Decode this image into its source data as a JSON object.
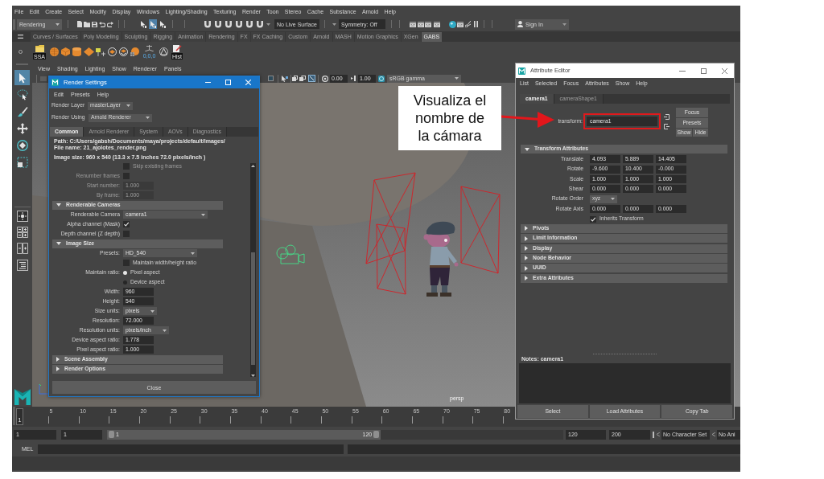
{
  "menu_bar": [
    "File",
    "Edit",
    "Create",
    "Select",
    "Modify",
    "Display",
    "Windows",
    "Lighting/Shading",
    "Texturing",
    "Render",
    "Toon",
    "Stereo",
    "Cache",
    "Substance",
    "Arnold",
    "Help"
  ],
  "status_line": {
    "menu_set": "Rendering",
    "select_modes": [
      {
        "selected": false
      },
      {
        "selected": true
      },
      {
        "selected": false
      }
    ],
    "live_surface": "No Live Surface",
    "symmetry": "Symmetry: Off",
    "sign_in": "Sign In"
  },
  "shelf": {
    "tabs": [
      {
        "label": "Curves / Surfaces",
        "selected": false
      },
      {
        "label": "Poly Modeling",
        "selected": false
      },
      {
        "label": "Sculpting",
        "selected": false
      },
      {
        "label": "Rigging",
        "selected": false
      },
      {
        "label": "Animation",
        "selected": false
      },
      {
        "label": "Rendering",
        "selected": false
      },
      {
        "label": "FX",
        "selected": false
      },
      {
        "label": "FX Caching",
        "selected": false
      },
      {
        "label": "Custom",
        "selected": false
      },
      {
        "label": "Arnold",
        "selected": false
      },
      {
        "label": "MASH",
        "selected": false
      },
      {
        "label": "Motion Graphics",
        "selected": false
      },
      {
        "label": "XGen",
        "selected": false
      },
      {
        "label": "GABS",
        "selected": true
      }
    ],
    "buttons": [
      {
        "kind": "folder",
        "label": "SSA"
      },
      {
        "kind": "sphere"
      },
      {
        "kind": "cube"
      },
      {
        "kind": "cylinder"
      },
      {
        "kind": "diamond"
      },
      {
        "kind": "target"
      },
      {
        "kind": "disc"
      },
      {
        "kind": "stack"
      },
      {
        "kind": "grid"
      },
      {
        "kind": "origin",
        "label": "0,0,0"
      },
      {
        "kind": "pivot"
      },
      {
        "kind": "notes",
        "label": "Hist"
      }
    ]
  },
  "toolbox": {
    "tools": [
      {
        "kind": "select",
        "selected": true
      },
      {
        "kind": "lasso",
        "selected": false
      },
      {
        "kind": "paint",
        "selected": false
      },
      {
        "kind": "move",
        "selected": false
      },
      {
        "kind": "rotate",
        "selected": false
      },
      {
        "kind": "scale",
        "selected": false
      }
    ]
  },
  "viewport": {
    "menu": [
      "View",
      "Shading",
      "Lighting",
      "Show",
      "Renderer",
      "Panels"
    ],
    "exposure": "0.00",
    "gamma": "1.00",
    "color_space": "sRGB gamma",
    "camera": "persp"
  },
  "render_settings": {
    "title": "Render Settings",
    "menu": [
      "Edit",
      "Presets",
      "Help"
    ],
    "render_layer": {
      "label": "Render Layer",
      "value": "masterLayer"
    },
    "render_using": {
      "label": "Render Using",
      "value": "Arnold Renderer"
    },
    "tabs": [
      {
        "label": "Common",
        "selected": true
      },
      {
        "label": "Arnold Renderer",
        "selected": false
      },
      {
        "label": "System",
        "selected": false
      },
      {
        "label": "AOVs",
        "selected": false
      },
      {
        "label": "Diagnostics",
        "selected": false
      }
    ],
    "path": "Path: C:/Users/gabsh/Documents/maya/projects/default/images/",
    "file_name": "File name: 21_ajolotes_render.png",
    "image_size": "Image size: 960 x 540 (13.3 x 7.5 inches 72.0 pixels/inch )",
    "rows": [
      {
        "kind": "checkoption",
        "text": "Skip existing frames",
        "checked": false,
        "disabled": true
      },
      {
        "kind": "checkbox",
        "label": "Renumber frames",
        "checked": false,
        "disabled": true
      },
      {
        "kind": "field",
        "label": "Start number:",
        "value": "1.000",
        "disabled": true
      },
      {
        "kind": "field",
        "label": "By frame:",
        "value": "1.000",
        "disabled": true
      },
      {
        "kind": "section",
        "label": "Renderable Cameras",
        "expanded": true
      },
      {
        "kind": "dropdown",
        "label": "Renderable Camera",
        "value": "camera1",
        "disabled": false
      },
      {
        "kind": "checkbox",
        "label": "Alpha channel (Mask)",
        "checked": true,
        "disabled": false
      },
      {
        "kind": "checkbox",
        "label": "Depth channel (Z depth)",
        "checked": false,
        "disabled": false
      },
      {
        "kind": "section",
        "label": "Image Size",
        "expanded": true
      },
      {
        "kind": "dropdown",
        "label": "Presets:",
        "value": "HD_540",
        "disabled": false
      },
      {
        "kind": "checkoption",
        "text": "Maintain width/height ratio",
        "checked": false,
        "disabled": false
      },
      {
        "kind": "radio",
        "label": "Maintain ratio:",
        "text": "Pixel aspect",
        "selected": true,
        "disabled": false
      },
      {
        "kind": "radio",
        "text": "Device aspect",
        "selected": false,
        "disabled": false
      },
      {
        "kind": "field",
        "label": "Width:",
        "value": "960",
        "disabled": false
      },
      {
        "kind": "field",
        "label": "Height:",
        "value": "540",
        "disabled": false
      },
      {
        "kind": "dropdown",
        "label": "Size units:",
        "value": "pixels",
        "disabled": false
      },
      {
        "kind": "field",
        "label": "Resolution:",
        "value": "72.000",
        "disabled": false
      },
      {
        "kind": "dropdown",
        "label": "Resolution units:",
        "value": "pixels/inch",
        "disabled": false
      },
      {
        "kind": "field",
        "label": "Device aspect ratio:",
        "value": "1.778",
        "disabled": false
      },
      {
        "kind": "field",
        "label": "Pixel aspect ratio:",
        "value": "1.000",
        "disabled": false
      },
      {
        "kind": "section",
        "label": "Scene Assembly",
        "expanded": false
      },
      {
        "kind": "section",
        "label": "Render Options",
        "expanded": false
      }
    ],
    "close": "Close"
  },
  "attribute_editor": {
    "title": "Attribute Editor",
    "menu": [
      "List",
      "Selected",
      "Focus",
      "Attributes",
      "Show",
      "Help"
    ],
    "tabs": [
      {
        "label": "camera1",
        "selected": true
      },
      {
        "label": "cameraShape1",
        "selected": false
      }
    ],
    "node": {
      "label": "transform:",
      "value": "camera1"
    },
    "buttons": [
      "Focus",
      "Presets",
      "Show",
      "Hide"
    ],
    "sections": [
      {
        "label": "Transform Attributes",
        "expanded": true,
        "rows": [
          {
            "kind": "vector",
            "label": "Translate",
            "values": [
              "4.093",
              "5.889",
              "14.405"
            ]
          },
          {
            "kind": "vector",
            "label": "Rotate",
            "values": [
              "-9.600",
              "10.400",
              "-0.000"
            ]
          },
          {
            "kind": "vector",
            "label": "Scale",
            "values": [
              "1.000",
              "1.000",
              "1.000"
            ]
          },
          {
            "kind": "vector",
            "label": "Shear",
            "values": [
              "0.000",
              "0.000",
              "0.000"
            ]
          },
          {
            "kind": "dropdown",
            "label": "Rotate Order",
            "value": "xyz"
          },
          {
            "kind": "vector",
            "label": "Rotate Axis",
            "values": [
              "0.000",
              "0.000",
              "0.000"
            ]
          },
          {
            "kind": "checkbox",
            "text": "Inherits Transform",
            "checked": true
          }
        ]
      },
      {
        "label": "Pivots",
        "expanded": false
      },
      {
        "label": "Limit Information",
        "expanded": false
      },
      {
        "label": "Display",
        "expanded": false
      },
      {
        "label": "Node Behavior",
        "expanded": false
      },
      {
        "label": "UUID",
        "expanded": false
      },
      {
        "label": "Extra Attributes",
        "expanded": false
      }
    ],
    "notes_label": "Notes: camera1",
    "footer": [
      "Select",
      "Load Attributes",
      "Copy Tab"
    ]
  },
  "annotation": {
    "lines": [
      "Visualiza el",
      "nombre de",
      "la cámara"
    ]
  },
  "timeline": {
    "current_frame": "1",
    "ticks": [
      "5",
      "10",
      "15",
      "20",
      "25",
      "30",
      "35",
      "40",
      "45",
      "50",
      "55",
      "60",
      "65",
      "70",
      "75",
      "80"
    ]
  },
  "range_slider": {
    "start": "1",
    "range_start": "1",
    "level": 0.6,
    "handle_start": "1",
    "handle_end": "120",
    "range_end": "120",
    "end": "200",
    "character_set": "No Character Set",
    "anim_layer": "No Ani"
  },
  "command_line": {
    "language": "MEL"
  }
}
